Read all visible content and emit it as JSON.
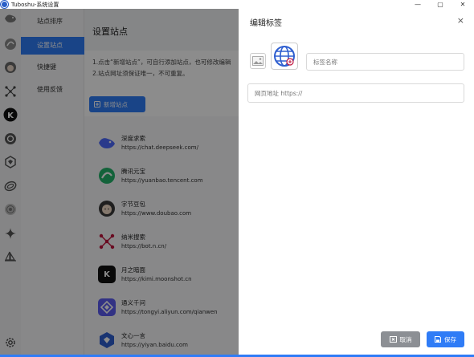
{
  "window": {
    "title": "Tuboshu-系统设置",
    "minimize": "—",
    "maximize": "▢",
    "close": "✕"
  },
  "menu": {
    "items": [
      {
        "label": "站点排序"
      },
      {
        "label": "设置站点",
        "active": true
      },
      {
        "label": "快捷键"
      },
      {
        "label": "使用反馈"
      }
    ]
  },
  "main": {
    "title": "设置站点",
    "hints": [
      "1.点击“新增站点”，可自行添加站点，也可修改编辑",
      "2.站点网址须保证唯一，不可重复。"
    ],
    "add_button": "新增站点"
  },
  "sites": [
    {
      "name": "深度求索",
      "url": "https://chat.deepseek.com/",
      "color": "#4d6bfe",
      "logo": "🐋"
    },
    {
      "name": "腾讯元宝",
      "url": "https://yuanbao.tencent.com",
      "color": "#23b36b",
      "logo": "◐"
    },
    {
      "name": "字节豆包",
      "url": "https://www.doubao.com",
      "color": "#f4c7a1",
      "logo": "☺"
    },
    {
      "name": "纳米搜索",
      "url": "https://bot.n.cn/",
      "color": "#ffffff",
      "logo": "✱"
    },
    {
      "name": "月之暗面",
      "url": "https://kimi.moonshot.cn",
      "color": "#111111",
      "logo": "K"
    },
    {
      "name": "通义千问",
      "url": "https://tongyi.aliyun.com/qianwen",
      "color": "#5b5bf0",
      "logo": "◈"
    },
    {
      "name": "文心一言",
      "url": "https://yiyan.baidu.com",
      "color": "#2f5fd0",
      "logo": "◆"
    }
  ],
  "drawer": {
    "title": "编辑标签",
    "close_icon": "×",
    "name_placeholder": "标签名称",
    "url_placeholder": "网页地址 https://",
    "cancel_label": "取消",
    "save_label": "保存"
  },
  "colors": {
    "accent": "#2f7cf6",
    "cancel": "#8c8f94"
  }
}
